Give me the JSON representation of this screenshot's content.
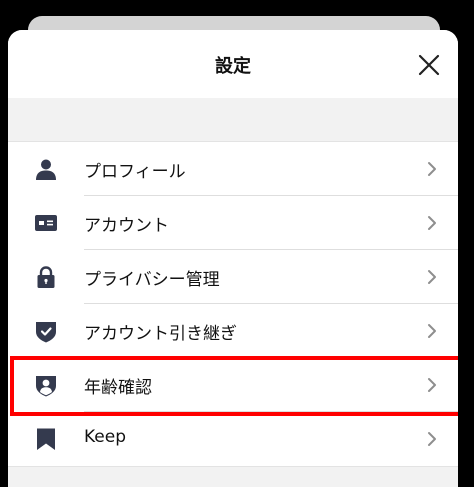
{
  "header": {
    "title": "設定",
    "close_icon": "close-icon"
  },
  "settings": {
    "items": [
      {
        "label": "プロフィール",
        "icon": "person-icon"
      },
      {
        "label": "アカウント",
        "icon": "id-card-icon"
      },
      {
        "label": "プライバシー管理",
        "icon": "lock-icon"
      },
      {
        "label": "アカウント引き継ぎ",
        "icon": "shield-check-icon"
      },
      {
        "label": "年齢確認",
        "icon": "shield-person-icon",
        "highlighted": true
      },
      {
        "label": "Keep",
        "icon": "bookmark-icon"
      }
    ]
  },
  "colors": {
    "icon": "#343a4e",
    "highlight_border": "#ff0000",
    "chevron": "#8e8e8e",
    "gap_background": "#f2f2f2"
  }
}
